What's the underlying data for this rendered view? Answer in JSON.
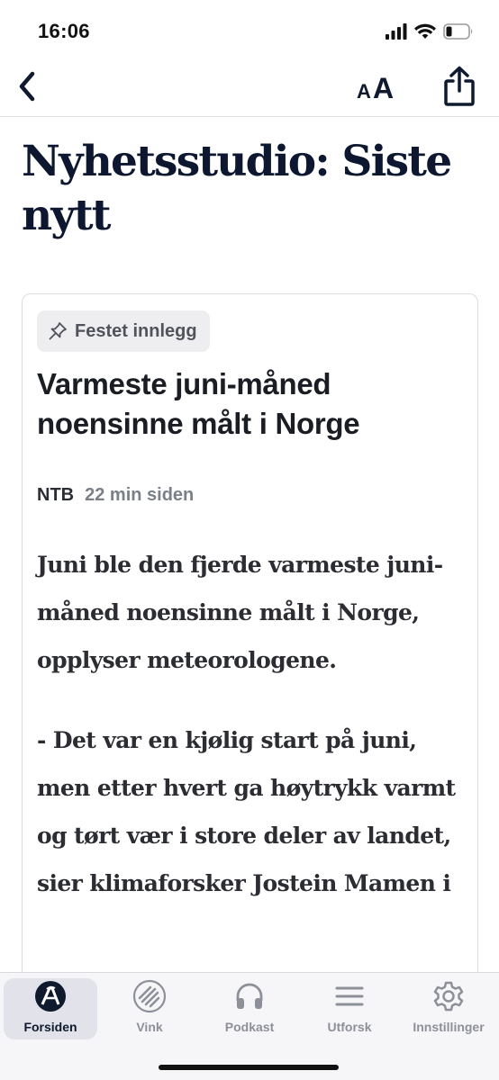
{
  "status_bar": {
    "time": "16:06",
    "signal_icon": "cellular-signal-icon",
    "wifi_icon": "wifi-icon",
    "battery_icon": "battery-low-icon",
    "battery_level": 0.2
  },
  "nav": {
    "back_icon": "chevron-left-icon",
    "font_size_small": "A",
    "font_size_large": "A",
    "share_icon": "share-icon"
  },
  "page": {
    "title": "Nyhetsstudio: Siste nytt"
  },
  "article": {
    "pinned_label": "Festet innlegg",
    "pin_icon": "pin-icon",
    "headline": "Varmeste juni-måned noensinne målt i Norge",
    "source": "NTB",
    "time_ago": "22 min siden",
    "paragraphs": [
      "Juni ble den fjerde varmeste juni-måned noensinne målt i Norge, opplyser meteorologene.",
      "- Det var en kjølig start på juni, men etter hvert ga høytrykk varmt og tørt vær i store deler av landet, sier klimaforsker Jostein Mamen i"
    ]
  },
  "tabs": [
    {
      "label": "Forsiden",
      "icon": "aftenposten-logo-icon",
      "active": true
    },
    {
      "label": "Vink",
      "icon": "vink-icon",
      "active": false
    },
    {
      "label": "Podkast",
      "icon": "headphones-icon",
      "active": false
    },
    {
      "label": "Utforsk",
      "icon": "menu-lines-icon",
      "active": false
    },
    {
      "label": "Innstillinger",
      "icon": "gear-icon",
      "active": false
    }
  ],
  "colors": {
    "accent": "#0f1a2e",
    "tab_inactive": "#8d9098",
    "badge_bg": "#eeeef1"
  }
}
